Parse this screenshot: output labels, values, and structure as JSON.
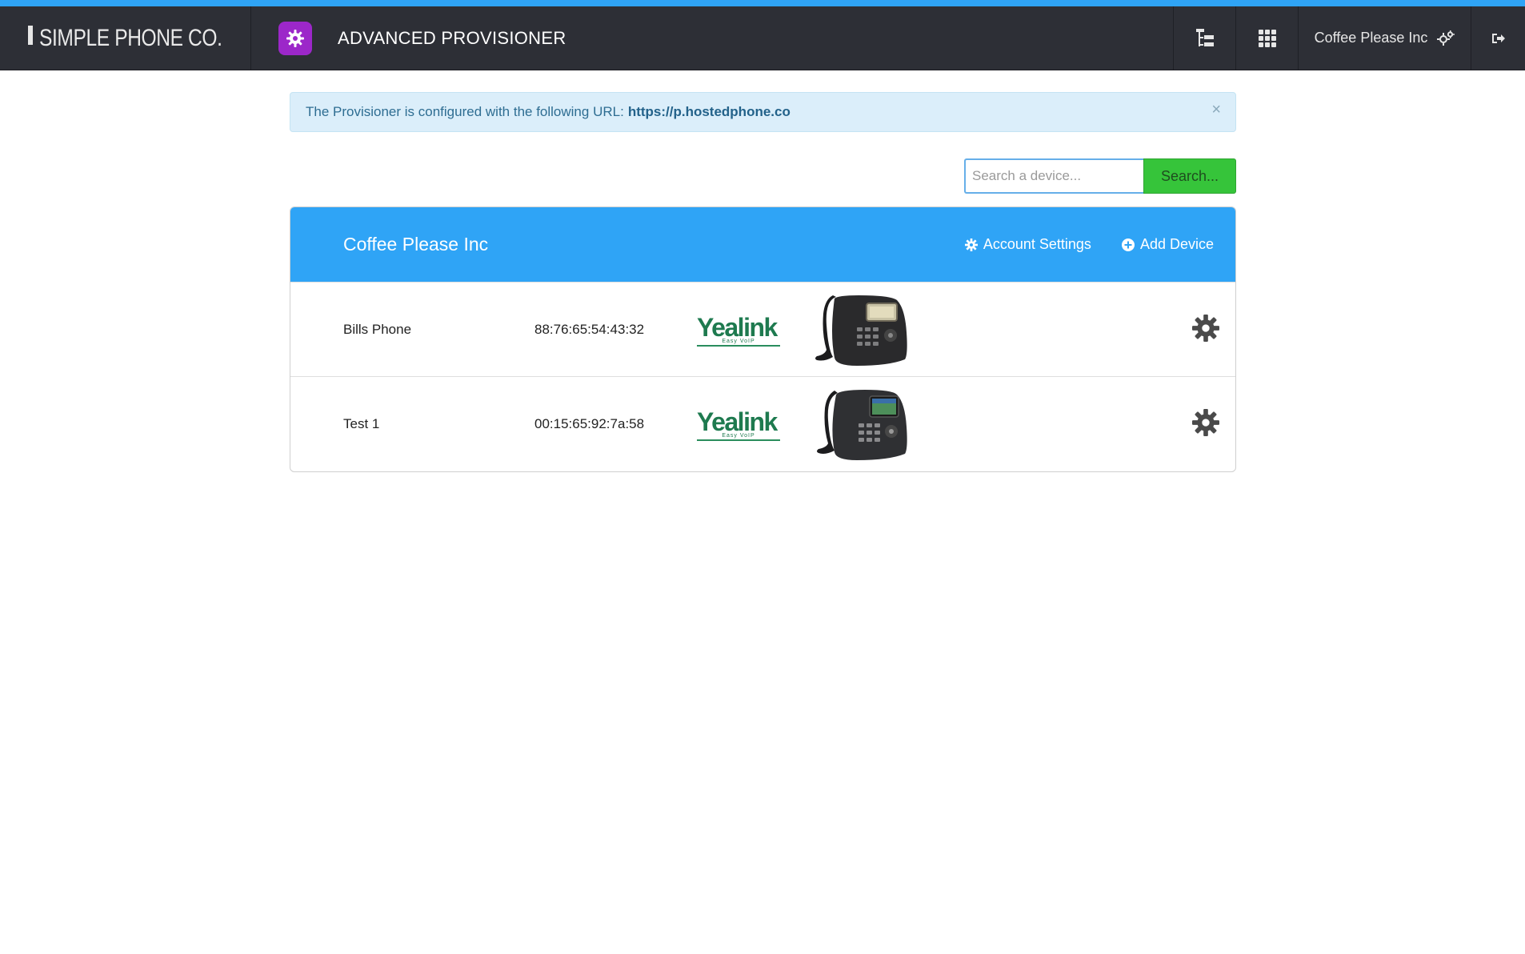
{
  "header": {
    "brand": "SIMPLE PHONE CO.",
    "app_title": "ADVANCED PROVISIONER",
    "account_name": "Coffee Please Inc"
  },
  "alert": {
    "text": "The Provisioner is configured with the following URL:",
    "url": "https://p.hostedphone.co",
    "close": "×"
  },
  "search": {
    "placeholder": "Search a device...",
    "button": "Search..."
  },
  "panel": {
    "title": "Coffee Please Inc",
    "account_settings": "Account Settings",
    "add_device": "Add Device"
  },
  "devices": [
    {
      "name": "Bills Phone",
      "mac": "88:76:65:54:43:32",
      "brand": "Yealink",
      "brand_tagline": "Easy VoIP"
    },
    {
      "name": "Test 1",
      "mac": "00:15:65:92:7a:58",
      "brand": "Yealink",
      "brand_tagline": "Easy VoIP"
    }
  ],
  "colors": {
    "accent": "#2fa4f6",
    "topbar": "#2d2f36",
    "app_icon": "#9c27c9",
    "search_button": "#36c43a",
    "alert_bg": "#dbeefa"
  }
}
